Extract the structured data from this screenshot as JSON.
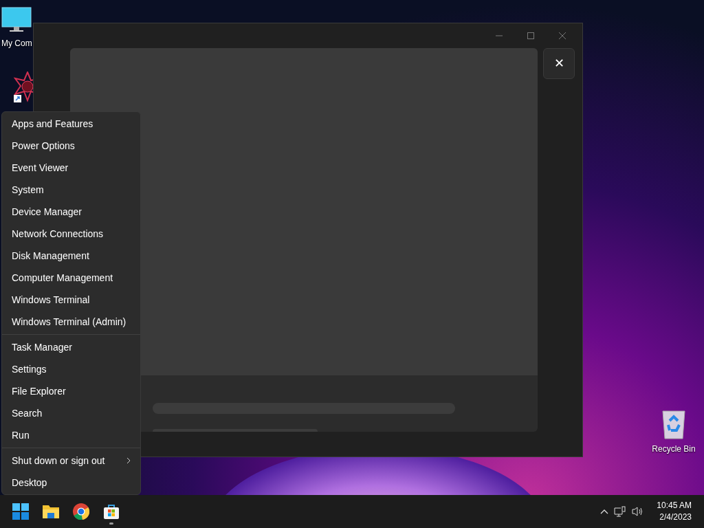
{
  "desktop_icons": [
    {
      "kind": "computer",
      "label": "My Com"
    },
    {
      "kind": "shortcut"
    },
    {
      "kind": "recycle-bin",
      "label": "Recycle Bin"
    }
  ],
  "window": {
    "dialog": {
      "close_glyph": "✕"
    }
  },
  "context_menu": {
    "groups": [
      {
        "items": [
          {
            "label": "Apps and Features",
            "submenu": false
          },
          {
            "label": "Power Options",
            "submenu": false
          },
          {
            "label": "Event Viewer",
            "submenu": false
          },
          {
            "label": "System",
            "submenu": false
          },
          {
            "label": "Device Manager",
            "submenu": false
          },
          {
            "label": "Network Connections",
            "submenu": false
          },
          {
            "label": "Disk Management",
            "submenu": false
          },
          {
            "label": "Computer Management",
            "submenu": false
          },
          {
            "label": "Windows Terminal",
            "submenu": false
          },
          {
            "label": "Windows Terminal (Admin)",
            "submenu": false
          }
        ]
      },
      {
        "items": [
          {
            "label": "Task Manager",
            "submenu": false
          },
          {
            "label": "Settings",
            "submenu": false
          },
          {
            "label": "File Explorer",
            "submenu": false
          },
          {
            "label": "Search",
            "submenu": false
          },
          {
            "label": "Run",
            "submenu": false
          }
        ]
      },
      {
        "items": [
          {
            "label": "Shut down or sign out",
            "submenu": true
          },
          {
            "label": "Desktop",
            "submenu": false
          }
        ]
      }
    ]
  },
  "taskbar": {
    "apps": [
      {
        "kind": "start",
        "running": false
      },
      {
        "kind": "explorer",
        "running": false
      },
      {
        "kind": "chrome",
        "running": false
      },
      {
        "kind": "store",
        "running": true
      }
    ],
    "tray": {
      "time": "10:45 AM",
      "date": "2/4/2023"
    }
  }
}
